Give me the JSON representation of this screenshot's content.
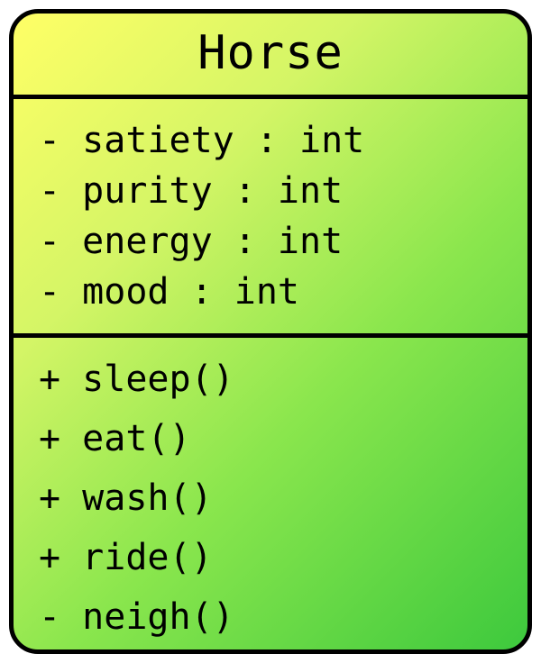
{
  "class": {
    "name": "Horse",
    "attributes": [
      {
        "visibility": "-",
        "name": "satiety",
        "type": "int"
      },
      {
        "visibility": "-",
        "name": "purity",
        "type": "int"
      },
      {
        "visibility": "-",
        "name": "energy",
        "type": "int"
      },
      {
        "visibility": "-",
        "name": "mood",
        "type": "int"
      }
    ],
    "methods": [
      {
        "visibility": "+",
        "name": "sleep"
      },
      {
        "visibility": "+",
        "name": "eat"
      },
      {
        "visibility": "+",
        "name": "wash"
      },
      {
        "visibility": "+",
        "name": "ride"
      },
      {
        "visibility": "-",
        "name": "neigh"
      }
    ]
  }
}
